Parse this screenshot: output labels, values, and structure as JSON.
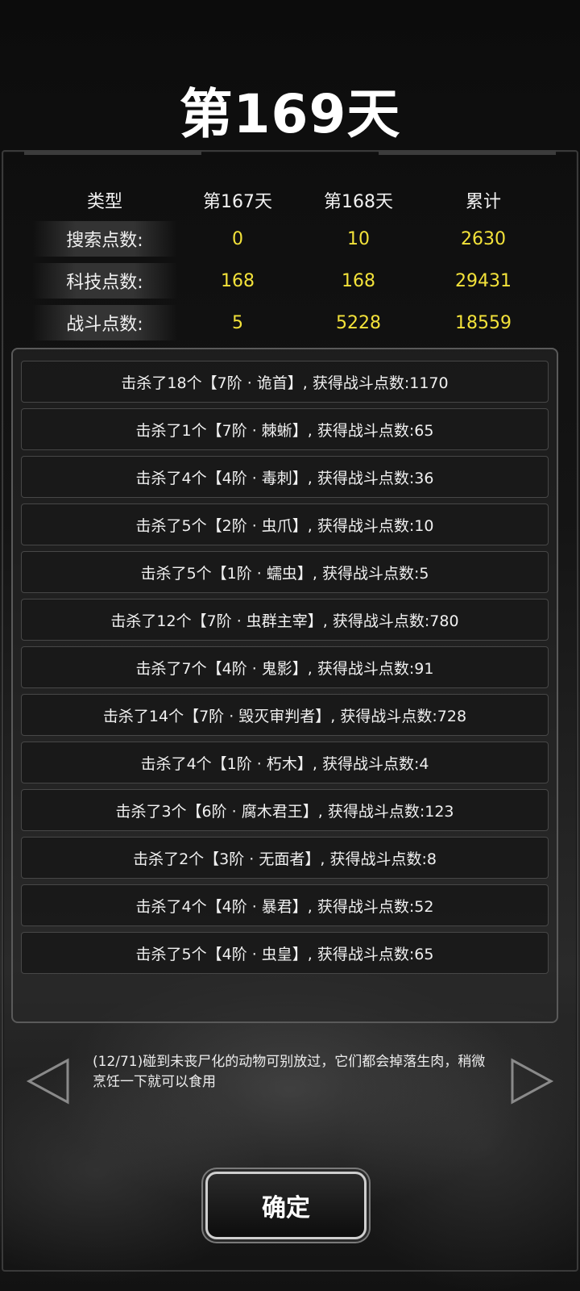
{
  "title": "第169天",
  "stats": {
    "headers": [
      "类型",
      "第167天",
      "第168天",
      "累计"
    ],
    "rows": [
      {
        "label": "搜索点数:",
        "d167": "0",
        "d168": "10",
        "total": "2630"
      },
      {
        "label": "科技点数:",
        "d167": "168",
        "d168": "168",
        "total": "29431"
      },
      {
        "label": "战斗点数:",
        "d167": "5",
        "d168": "5228",
        "total": "18559"
      }
    ]
  },
  "kills": [
    "击杀了18个【7阶 · 诡首】, 获得战斗点数:1170",
    "击杀了1个【7阶 · 棘蜥】, 获得战斗点数:65",
    "击杀了4个【4阶 · 毒刺】, 获得战斗点数:36",
    "击杀了5个【2阶 · 虫爪】, 获得战斗点数:10",
    "击杀了5个【1阶 · 蠕虫】, 获得战斗点数:5",
    "击杀了12个【7阶 · 虫群主宰】, 获得战斗点数:780",
    "击杀了7个【4阶 · 鬼影】, 获得战斗点数:91",
    "击杀了14个【7阶 · 毁灭审判者】, 获得战斗点数:728",
    "击杀了4个【1阶 · 朽木】, 获得战斗点数:4",
    "击杀了3个【6阶 · 腐木君王】, 获得战斗点数:123",
    "击杀了2个【3阶 · 无面者】, 获得战斗点数:8",
    "击杀了4个【4阶 · 暴君】, 获得战斗点数:52",
    "击杀了5个【4阶 · 虫皇】, 获得战斗点数:65"
  ],
  "tip": "(12/71)碰到未丧尸化的动物可别放过，它们都会掉落生肉，稍微烹饪一下就可以食用",
  "confirm_label": "确定",
  "icons": {
    "prev": "triangle-left-icon",
    "next": "triangle-right-icon"
  }
}
